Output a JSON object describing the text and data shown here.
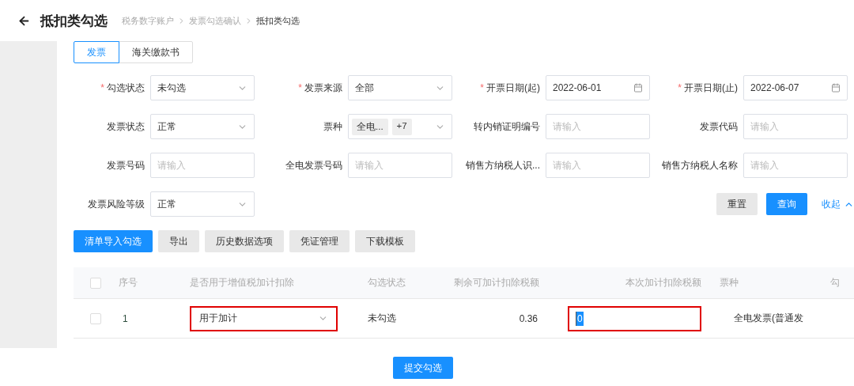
{
  "header": {
    "title": "抵扣类勾选",
    "breadcrumb": [
      {
        "label": "税务数字账户",
        "current": false
      },
      {
        "label": "发票勾选确认",
        "current": false
      },
      {
        "label": "抵扣类勾选",
        "current": true
      }
    ]
  },
  "tabs": [
    {
      "label": "发票",
      "selected": true
    },
    {
      "label": "海关缴款书",
      "selected": false
    }
  ],
  "filters": [
    {
      "kind": "select",
      "label": "勾选状态",
      "required_mark": "*",
      "value": "未勾选"
    },
    {
      "kind": "select",
      "label": "发票来源",
      "required_mark": "*",
      "value": "全部"
    },
    {
      "kind": "date",
      "label": "开票日期(起)",
      "required_mark": "*",
      "value": "2022-06-01"
    },
    {
      "kind": "date",
      "label": "开票日期(止)",
      "required_mark": "*",
      "value": "2022-06-07"
    },
    {
      "kind": "select",
      "label": "发票状态",
      "value": "正常"
    },
    {
      "kind": "tags",
      "label": "票种",
      "tags": [
        "全电...",
        "+7"
      ]
    },
    {
      "kind": "input",
      "label": "转内销证明编号",
      "placeholder": "请输入"
    },
    {
      "kind": "input",
      "label": "发票代码",
      "placeholder": "请输入"
    },
    {
      "kind": "input",
      "label": "发票号码",
      "placeholder": "请输入"
    },
    {
      "kind": "input",
      "label": "全电发票号码",
      "placeholder": "请输入"
    },
    {
      "kind": "input",
      "label": "销售方纳税人识...",
      "placeholder": "请输入"
    },
    {
      "kind": "input",
      "label": "销售方纳税人名称",
      "placeholder": "请输入"
    },
    {
      "kind": "select",
      "label": "发票风险等级",
      "value": "正常"
    }
  ],
  "filter_actions": {
    "reset": "重置",
    "query": "查询",
    "collapse": "收起"
  },
  "toolbar": [
    {
      "label": "清单导入勾选",
      "primary": true
    },
    {
      "label": "导出",
      "primary": false
    },
    {
      "label": "历史数据选项",
      "primary": false
    },
    {
      "label": "凭证管理",
      "primary": false
    },
    {
      "label": "下载模板",
      "primary": false
    }
  ],
  "table": {
    "select_all_checked": false,
    "columns": [
      "序号",
      "是否用于增值税加计扣除",
      "勾选状态",
      "剩余可加计扣除税额",
      "本次加计扣除税额",
      "票种",
      "勾"
    ],
    "rows": [
      {
        "checked": false,
        "index": "1",
        "deduction_use": {
          "value": "用于加计",
          "highlighted": true
        },
        "status": "未勾选",
        "remaining": "0.36",
        "current_amount": {
          "value": "0",
          "highlighted": true
        },
        "invoice_type": "全电发票(普通发"
      }
    ]
  },
  "submit": "提交勾选"
}
